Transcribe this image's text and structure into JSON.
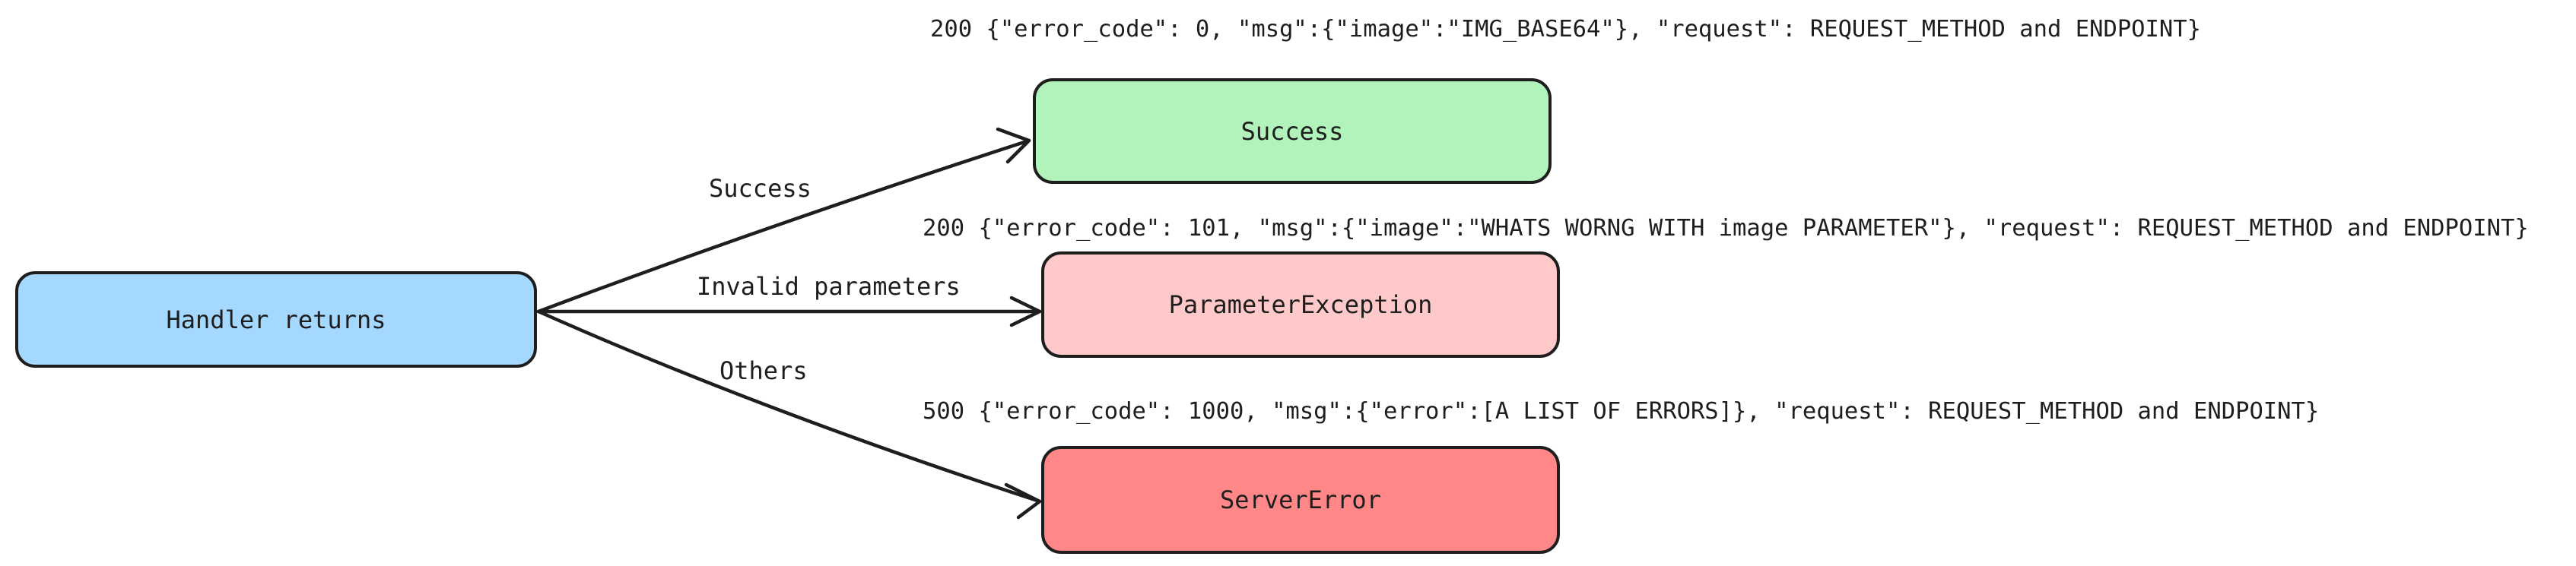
{
  "nodes": {
    "handler": {
      "label": "Handler returns",
      "color": "#a5d8ff"
    },
    "success": {
      "label": "Success",
      "color": "#b2f2bb"
    },
    "parameter_exception": {
      "label": "ParameterException",
      "color": "#ffc9c9"
    },
    "server_error": {
      "label": "ServerError",
      "color": "#ff8787"
    }
  },
  "edges": {
    "success": {
      "label": "Success"
    },
    "invalid": {
      "label": "Invalid parameters"
    },
    "others": {
      "label": "Others"
    }
  },
  "responses": {
    "success": "200 {\"error_code\": 0, \"msg\":{\"image\":\"IMG_BASE64\"}, \"request\": REQUEST_METHOD and ENDPOINT}",
    "parameter_exception": "200 {\"error_code\": 101, \"msg\":{\"image\":\"WHATS WORNG WITH image PARAMETER\"}, \"request\": REQUEST_METHOD and ENDPOINT}",
    "server_error": "500 {\"error_code\": 1000, \"msg\":{\"error\":[A LIST OF ERRORS]}, \"request\": REQUEST_METHOD and ENDPOINT}"
  },
  "colors": {
    "stroke": "#1e1e1e"
  }
}
